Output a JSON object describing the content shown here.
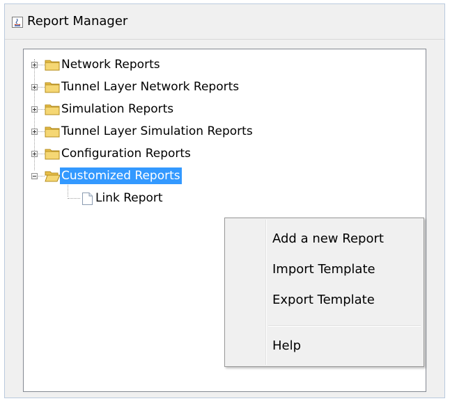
{
  "window": {
    "title": "Report Manager",
    "icon": "java-app-icon"
  },
  "tree": {
    "nodes": [
      {
        "label": "Network Reports",
        "expanded": false,
        "icon": "folder-icon"
      },
      {
        "label": "Tunnel Layer Network Reports",
        "expanded": false,
        "icon": "folder-icon"
      },
      {
        "label": "Simulation Reports",
        "expanded": false,
        "icon": "folder-icon"
      },
      {
        "label": "Tunnel Layer Simulation Reports",
        "expanded": false,
        "icon": "folder-icon"
      },
      {
        "label": "Configuration Reports",
        "expanded": false,
        "icon": "folder-icon"
      },
      {
        "label": "Customized Reports",
        "expanded": true,
        "selected": true,
        "icon": "folder-open-icon",
        "children": [
          {
            "label": "Link Report",
            "icon": "file-icon"
          }
        ]
      }
    ]
  },
  "context_menu": {
    "items": [
      {
        "label": "Add a new Report"
      },
      {
        "label": "Import Template"
      },
      {
        "label": "Export Template"
      },
      {
        "label": "Help"
      }
    ]
  },
  "colors": {
    "selection": "#3399ff",
    "folder": "#f2d16b",
    "window_bg": "#f0f0f0"
  }
}
